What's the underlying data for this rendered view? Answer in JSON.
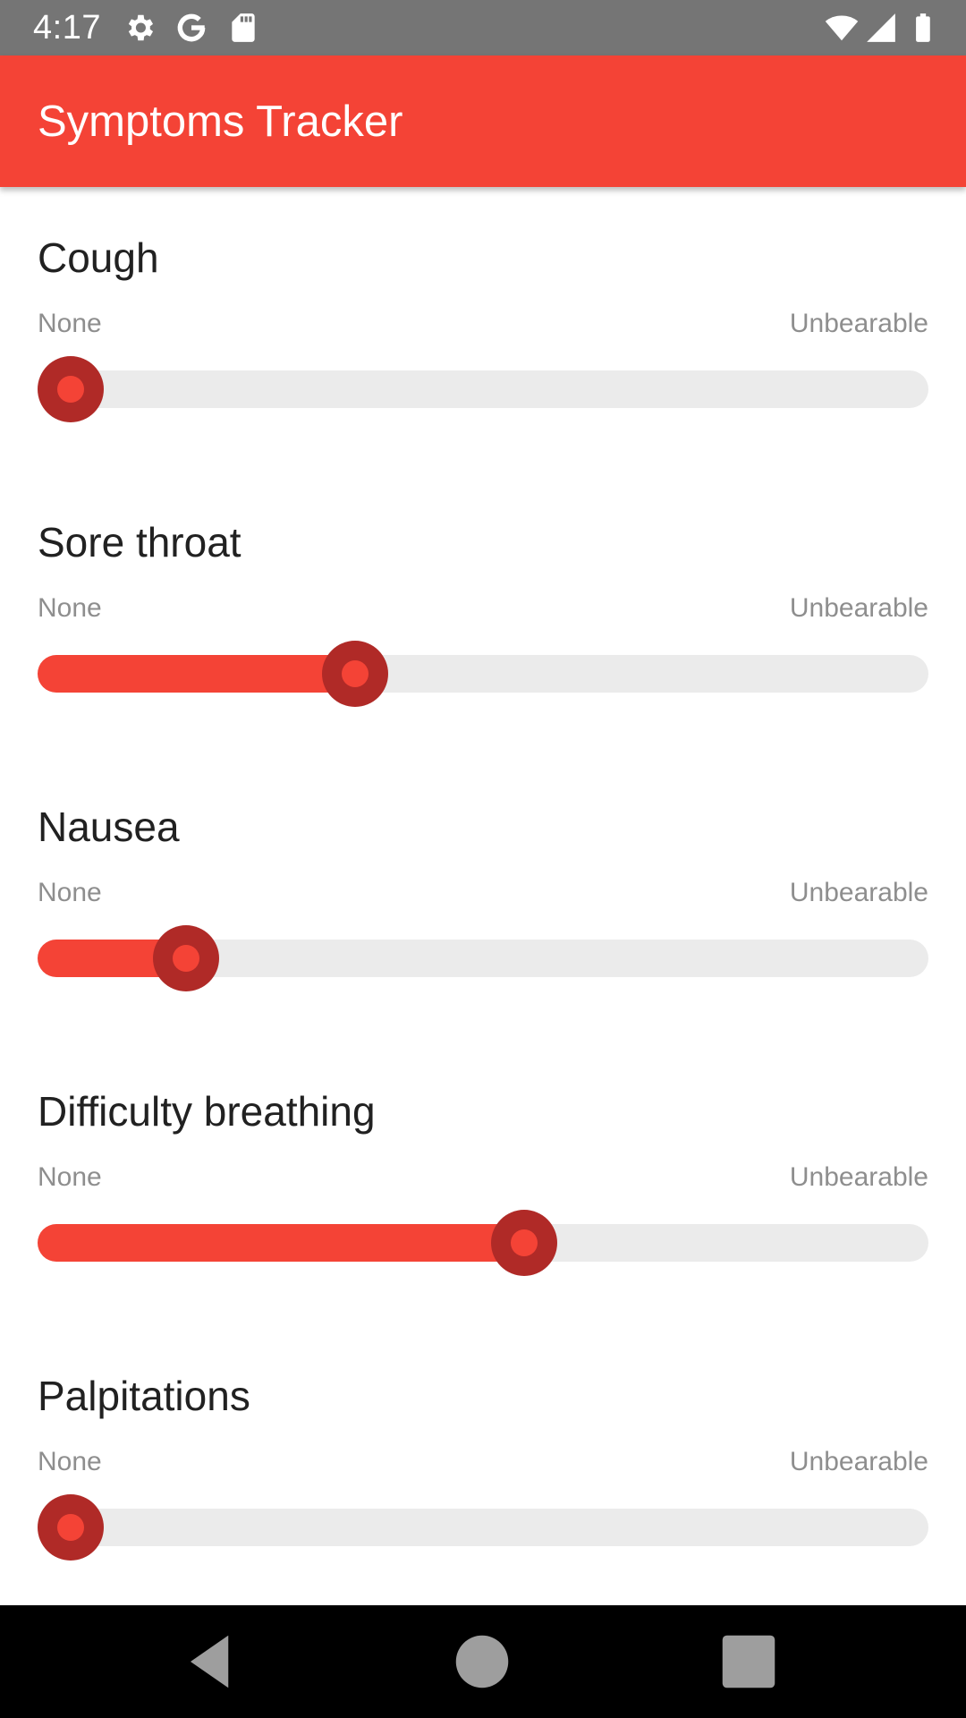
{
  "status_bar": {
    "time": "4:17",
    "icons": [
      "gear-icon",
      "google-icon",
      "sd-card-icon",
      "wifi-icon",
      "cell-signal-icon",
      "battery-icon"
    ]
  },
  "app_bar": {
    "title": "Symptoms Tracker",
    "color": "#f44336"
  },
  "symptoms": [
    {
      "name": "Cough",
      "min_label": "None",
      "max_label": "Unbearable",
      "level": 0.0
    },
    {
      "name": "Sore throat",
      "min_label": "None",
      "max_label": "Unbearable",
      "level": 0.345
    },
    {
      "name": "Nausea",
      "min_label": "None",
      "max_label": "Unbearable",
      "level": 0.14
    },
    {
      "name": "Difficulty breathing",
      "min_label": "None",
      "max_label": "Unbearable",
      "level": 0.55
    },
    {
      "name": "Palpitations",
      "min_label": "None",
      "max_label": "Unbearable",
      "level": 0.0
    }
  ],
  "colors": {
    "accent": "#f44336",
    "thumb": "#b02a27",
    "track": "#ebebeb"
  },
  "nav_bar": {
    "icons": [
      "back-icon",
      "home-icon",
      "recents-icon"
    ]
  }
}
